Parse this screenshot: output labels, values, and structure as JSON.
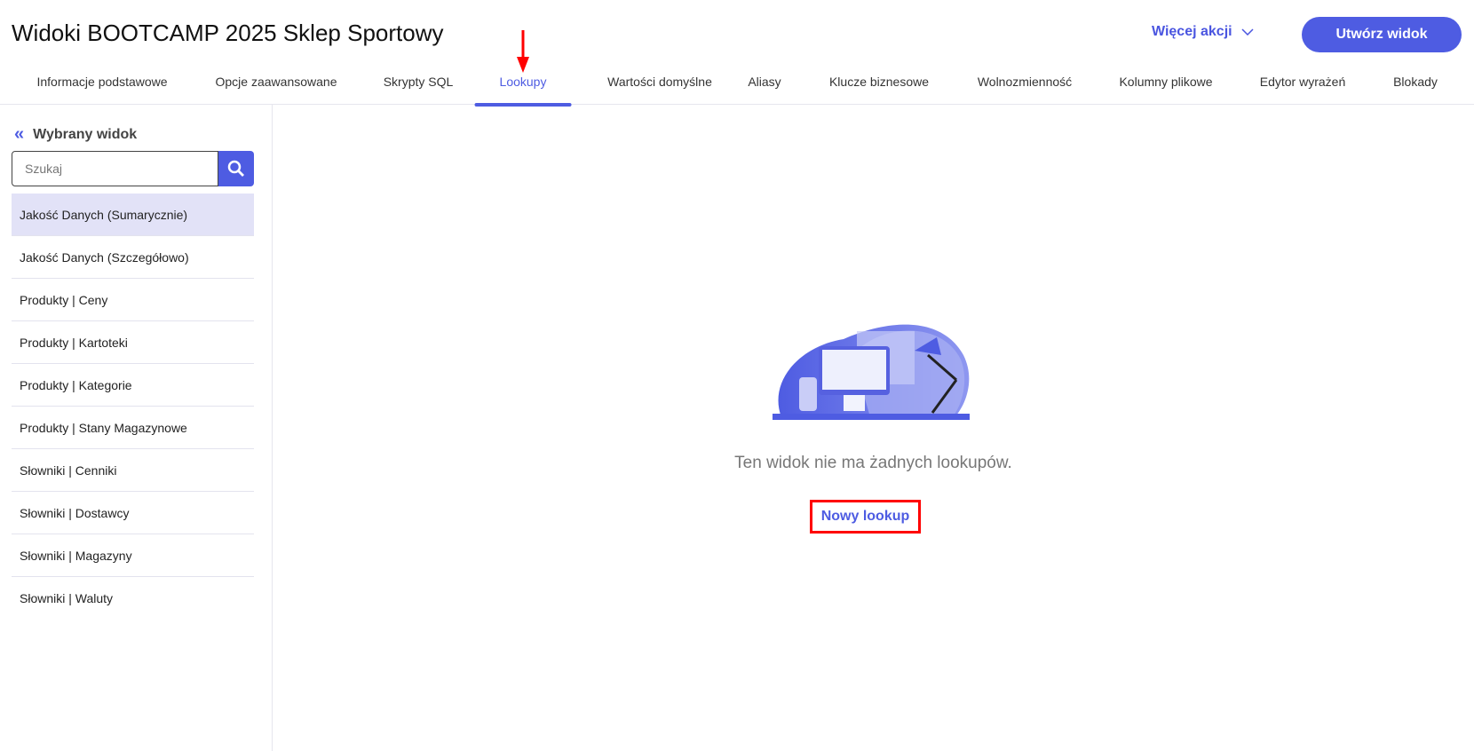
{
  "header": {
    "title": "Widoki BOOTCAMP 2025 Sklep Sportowy",
    "more_actions": "Więcej akcji",
    "create_button": "Utwórz widok"
  },
  "tabs": [
    "Informacje podstawowe",
    "Opcje zaawansowane",
    "Skrypty SQL",
    "Lookupy",
    "Wartości domyślne",
    "Aliasy",
    "Klucze biznesowe",
    "Wolnozmienność",
    "Kolumny plikowe",
    "Edytor wyrażeń",
    "Blokady"
  ],
  "active_tab": "Lookupy",
  "sidebar": {
    "heading": "Wybrany widok",
    "search_placeholder": "Szukaj",
    "items": [
      "Jakość Danych (Sumarycznie)",
      "Jakość Danych (Szczegółowo)",
      "Produkty | Ceny",
      "Produkty | Kartoteki",
      "Produkty | Kategorie",
      "Produkty | Stany Magazynowe",
      "Słowniki | Cenniki",
      "Słowniki | Dostawcy",
      "Słowniki | Magazyny",
      "Słowniki | Waluty"
    ]
  },
  "main": {
    "empty_message": "Ten widok nie ma żadnych lookupów.",
    "new_button": "Nowy lookup"
  },
  "colors": {
    "accent": "#4e5ce2",
    "annotation": "#ff0000"
  }
}
